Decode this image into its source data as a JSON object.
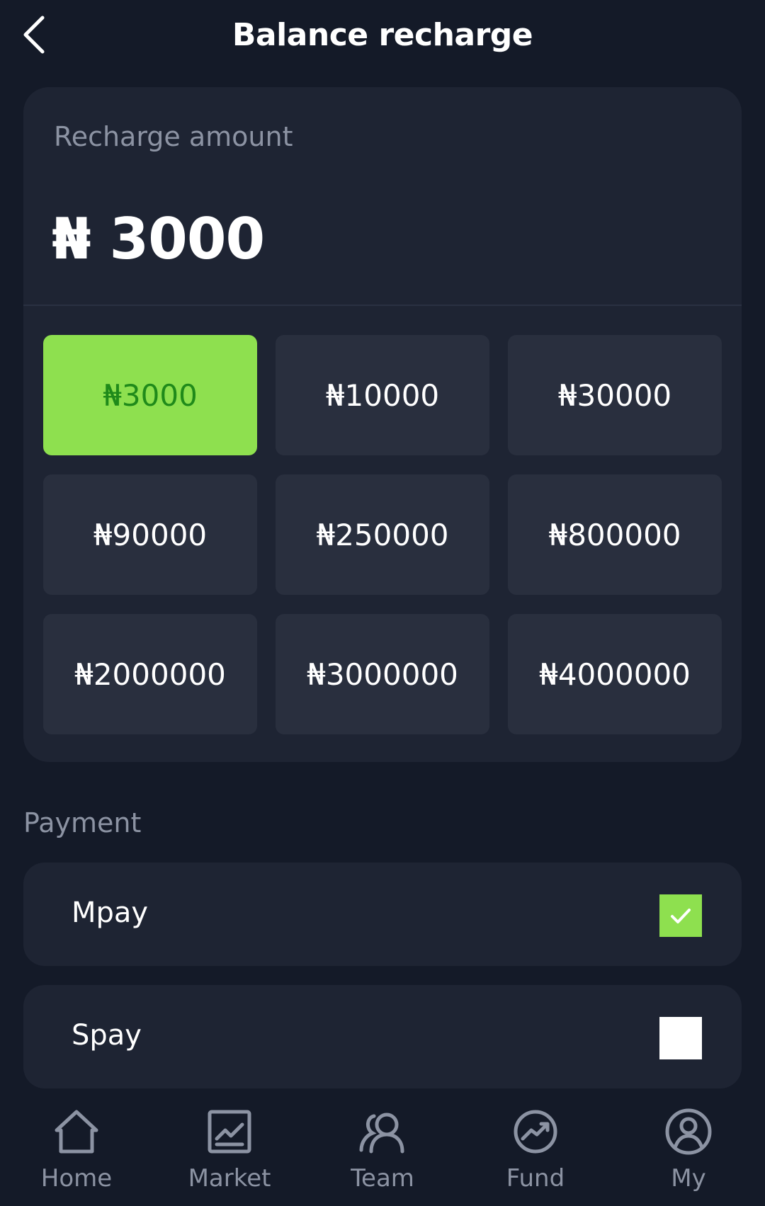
{
  "header": {
    "title": "Balance recharge",
    "back_icon": "chevron-left-icon"
  },
  "amount_card": {
    "label": "Recharge amount",
    "current_value": "₦ 3000",
    "options": [
      {
        "label": "₦3000",
        "selected": true
      },
      {
        "label": "₦10000",
        "selected": false
      },
      {
        "label": "₦30000",
        "selected": false
      },
      {
        "label": "₦90000",
        "selected": false
      },
      {
        "label": "₦250000",
        "selected": false
      },
      {
        "label": "₦800000",
        "selected": false
      },
      {
        "label": "₦2000000",
        "selected": false
      },
      {
        "label": "₦3000000",
        "selected": false
      },
      {
        "label": "₦4000000",
        "selected": false
      }
    ]
  },
  "payment": {
    "label": "Payment",
    "methods": [
      {
        "name": "Mpay",
        "checked": true
      },
      {
        "name": "Spay",
        "checked": false
      }
    ]
  },
  "tabbar": {
    "items": [
      {
        "label": "Home",
        "icon": "home-icon"
      },
      {
        "label": "Market",
        "icon": "market-chart-icon"
      },
      {
        "label": "Team",
        "icon": "team-icon"
      },
      {
        "label": "Fund",
        "icon": "fund-trend-icon"
      },
      {
        "label": "My",
        "icon": "profile-icon"
      }
    ]
  },
  "colors": {
    "background": "#141a28",
    "card": "#1e2433",
    "option": "#292f3e",
    "accent": "#8ee04f",
    "accent_text": "#1f8a1a",
    "muted_text": "#8c93a3"
  }
}
